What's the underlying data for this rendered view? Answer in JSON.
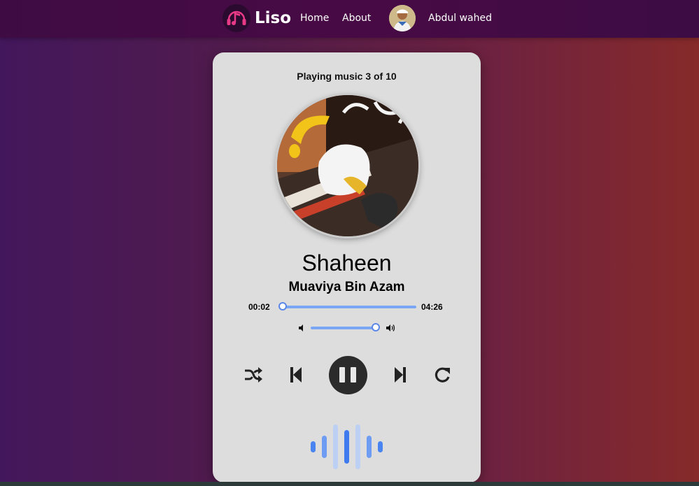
{
  "nav": {
    "brand": "Liso",
    "links": [
      {
        "label": "Home"
      },
      {
        "label": "About"
      }
    ],
    "user_name": "Abdul wahed",
    "logo_icon": "music-note-headphones-icon"
  },
  "player": {
    "status": "Playing music 3 of 10",
    "song_title": "Shaheen",
    "artist": "Muaviya Bin Azam",
    "current_time": "00:02",
    "duration": "04:26",
    "progress_fraction": 0.008,
    "volume_fraction": 1.0,
    "is_playing": true,
    "controls": [
      "shuffle-icon",
      "previous-icon",
      "pause-icon",
      "next-icon",
      "repeat-icon"
    ]
  },
  "colors": {
    "accent": "#7aa7f4",
    "card": "#dddddd",
    "nav": "#450a45"
  }
}
